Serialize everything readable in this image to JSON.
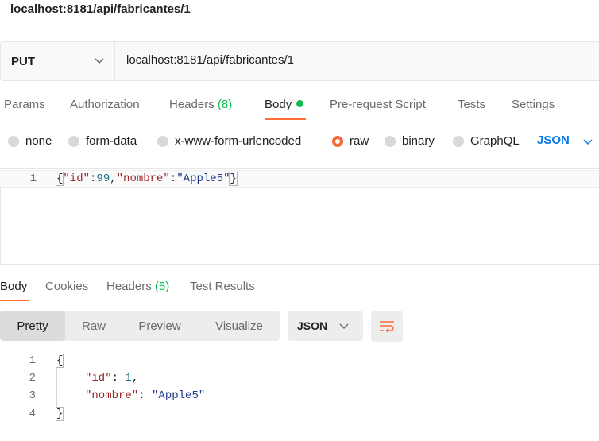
{
  "page": {
    "title": "localhost:8181/api/fabricantes/1"
  },
  "request": {
    "method": "PUT",
    "url": "localhost:8181/api/fabricantes/1"
  },
  "request_tabs": {
    "params": "Params",
    "authorization": "Authorization",
    "headers": "Headers",
    "headers_count": "(8)",
    "body": "Body",
    "prerequest": "Pre-request Script",
    "tests": "Tests",
    "settings": "Settings"
  },
  "body_types": {
    "none": "none",
    "form_data": "form-data",
    "urlencoded": "x-www-form-urlencoded",
    "raw": "raw",
    "binary": "binary",
    "graphql": "GraphQL",
    "selected": "raw",
    "language": "JSON"
  },
  "request_body": {
    "line_number": "1",
    "open": "{",
    "key1": "\"id\"",
    "colon1": ":",
    "val1": "99",
    "comma": ",",
    "key2": "\"nombre\"",
    "colon2": ":",
    "val2": "\"Apple5\"",
    "close": "}"
  },
  "response_tabs": {
    "body": "Body",
    "cookies": "Cookies",
    "headers": "Headers",
    "headers_count": "(5)",
    "test_results": "Test Results"
  },
  "response_view": {
    "pretty": "Pretty",
    "raw": "Raw",
    "preview": "Preview",
    "visualize": "Visualize",
    "format": "JSON"
  },
  "response_body": {
    "lines": [
      "1",
      "2",
      "3",
      "4"
    ],
    "open": "{",
    "key1": "\"id\"",
    "colon1": ": ",
    "val1": "1",
    "comma1": ",",
    "key2": "\"nombre\"",
    "colon2": ": ",
    "val2": "\"Apple5\"",
    "close": "}"
  },
  "icons": {
    "method_dropdown": "chevron-down-icon",
    "language_dropdown": "chevron-down-icon",
    "format_dropdown": "chevron-down-icon",
    "wrap": "wrap-lines-icon"
  },
  "colors": {
    "accent_orange": "#ff6c37",
    "count_green": "#0cbb52",
    "link_blue": "#097bed"
  }
}
